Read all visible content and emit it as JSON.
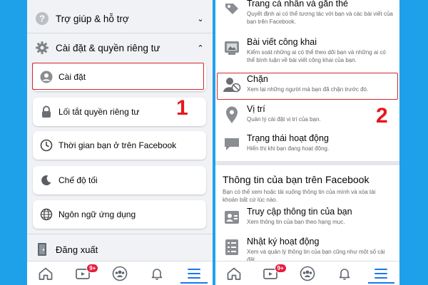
{
  "left": {
    "help": "Trợ giúp & hỗ trợ",
    "settings_privacy": "Cài đặt & quyền riêng tư",
    "items": [
      {
        "label": "Cài đặt"
      },
      {
        "label": "Lối tắt quyền riêng tư"
      },
      {
        "label": "Thời gian bạn ở trên Facebook"
      },
      {
        "label": "Chế độ tối"
      },
      {
        "label": "Ngôn ngữ ứng dụng"
      }
    ],
    "logout": "Đăng xuất",
    "step_number": "1",
    "badge": "9+"
  },
  "right": {
    "items": [
      {
        "title": "Trang cá nhân và gắn thẻ",
        "desc": "Quyết định ai có thể tương tác với bạn và các bài viết của bạn trên Facebook."
      },
      {
        "title": "Bài viết công khai",
        "desc": "Kiểm soát những ai có thể theo dõi bạn và những ai có thể bình luận về bài viết công khai của bạn."
      },
      {
        "title": "Chặn",
        "desc": "Xem lại những người mà bạn đã chặn trước đó."
      },
      {
        "title": "Vị trí",
        "desc": "Quản lý cài đặt vị trí của bạn."
      },
      {
        "title": "Trạng thái hoạt động",
        "desc": "Hiển thị khi bạn đang hoạt động."
      }
    ],
    "section_title": "Thông tin của bạn trên Facebook",
    "section_desc": "Bạn có thể xem hoặc tải xuống thông tin của mình và xóa tài khoản bất cứ lúc nào.",
    "info_items": [
      {
        "title": "Truy cập thông tin của bạn",
        "desc": "Xem thông tin của bạn theo hạng mục."
      },
      {
        "title": "Nhật ký hoạt động",
        "desc": "Xem và quản lý thông tin của bạn cũng như một số cài đặt."
      }
    ],
    "step_number": "2",
    "badge": "9+"
  },
  "colors": {
    "background": "#1fa1ea",
    "highlight": "#d6262b",
    "step_number": "#e8161c",
    "accent": "#1877f2"
  }
}
